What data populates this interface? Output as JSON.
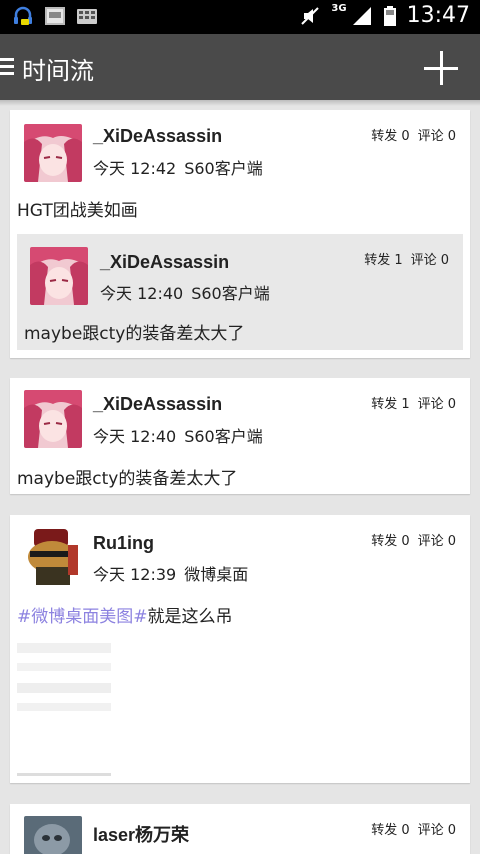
{
  "status_bar": {
    "time": "13:47",
    "network": "3G"
  },
  "header": {
    "title": "时间流"
  },
  "posts": [
    {
      "user": "_XiDeAssassin",
      "time": "今天 12:42",
      "source": "S60客户端",
      "reposts": "转发 0",
      "comments": "评论 0",
      "text": "HGT团战美如画",
      "quoted": {
        "user": "_XiDeAssassin",
        "time": "今天 12:40",
        "source": "S60客户端",
        "reposts": "转发 1",
        "comments": "评论 0",
        "text": "maybe跟cty的装备差太大了"
      }
    },
    {
      "user": "_XiDeAssassin",
      "time": "今天 12:40",
      "source": "S60客户端",
      "reposts": "转发 1",
      "comments": "评论 0",
      "text": "maybe跟cty的装备差太大了"
    },
    {
      "user": "Ru1ing",
      "time": "今天 12:39",
      "source": "微博桌面",
      "reposts": "转发 0",
      "comments": "评论 0",
      "hashtag": "#微博桌面美图#",
      "text": "就是这么吊"
    },
    {
      "user": "laser杨万荣",
      "reposts": "转发 0",
      "comments": "评论 0"
    }
  ]
}
